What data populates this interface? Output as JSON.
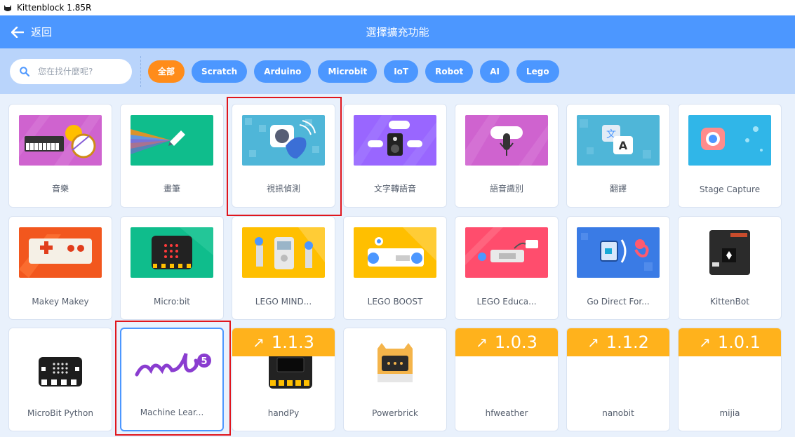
{
  "window": {
    "title": "Kittenblock 1.85R"
  },
  "header": {
    "back_label": "返回",
    "title": "選擇擴充功能"
  },
  "search": {
    "placeholder": "您在找什麼呢?"
  },
  "filters": [
    "全部",
    "Scratch",
    "Arduino",
    "Microbit",
    "IoT",
    "Robot",
    "AI",
    "Lego"
  ],
  "colors": {
    "header": "#4c97ff",
    "filterbar": "#b9d4fb",
    "active_filter": "#ff8c1a",
    "version_badge": "#ffb21c",
    "highlight": "#e0161d"
  },
  "extensions": [
    {
      "label": "音樂",
      "icon": "music-icon"
    },
    {
      "label": "畫筆",
      "icon": "pen-icon"
    },
    {
      "label": "視訊偵測",
      "icon": "video-sensing-icon"
    },
    {
      "label": "文字轉語音",
      "icon": "text-to-speech-icon"
    },
    {
      "label": "語音識別",
      "icon": "speech-recognition-icon"
    },
    {
      "label": "翻譯",
      "icon": "translate-icon"
    },
    {
      "label": "Stage Capture",
      "icon": "camera-icon"
    },
    {
      "label": "Makey Makey",
      "icon": "makey-makey-icon"
    },
    {
      "label": "Micro:bit",
      "icon": "microbit-icon"
    },
    {
      "label": "LEGO MIND...",
      "icon": "lego-mindstorms-icon"
    },
    {
      "label": "LEGO BOOST",
      "icon": "lego-boost-icon"
    },
    {
      "label": "LEGO Educa...",
      "icon": "lego-education-icon"
    },
    {
      "label": "Go Direct For...",
      "icon": "go-direct-force-icon"
    },
    {
      "label": "KittenBot",
      "icon": "kittenbot-board-icon"
    },
    {
      "label": "MicroBit Python",
      "icon": "microbit-python-icon"
    },
    {
      "label": "Machine Lear...",
      "icon": "ml5-icon"
    },
    {
      "label": "handPy",
      "icon": "handpy-board-icon",
      "version": "1.1.3"
    },
    {
      "label": "Powerbrick",
      "icon": "powerbrick-icon"
    },
    {
      "label": "hfweather",
      "icon": "",
      "version": "1.0.3"
    },
    {
      "label": "nanobit",
      "icon": "",
      "version": "1.1.2"
    },
    {
      "label": "mijia",
      "icon": "",
      "version": "1.0.1"
    }
  ]
}
